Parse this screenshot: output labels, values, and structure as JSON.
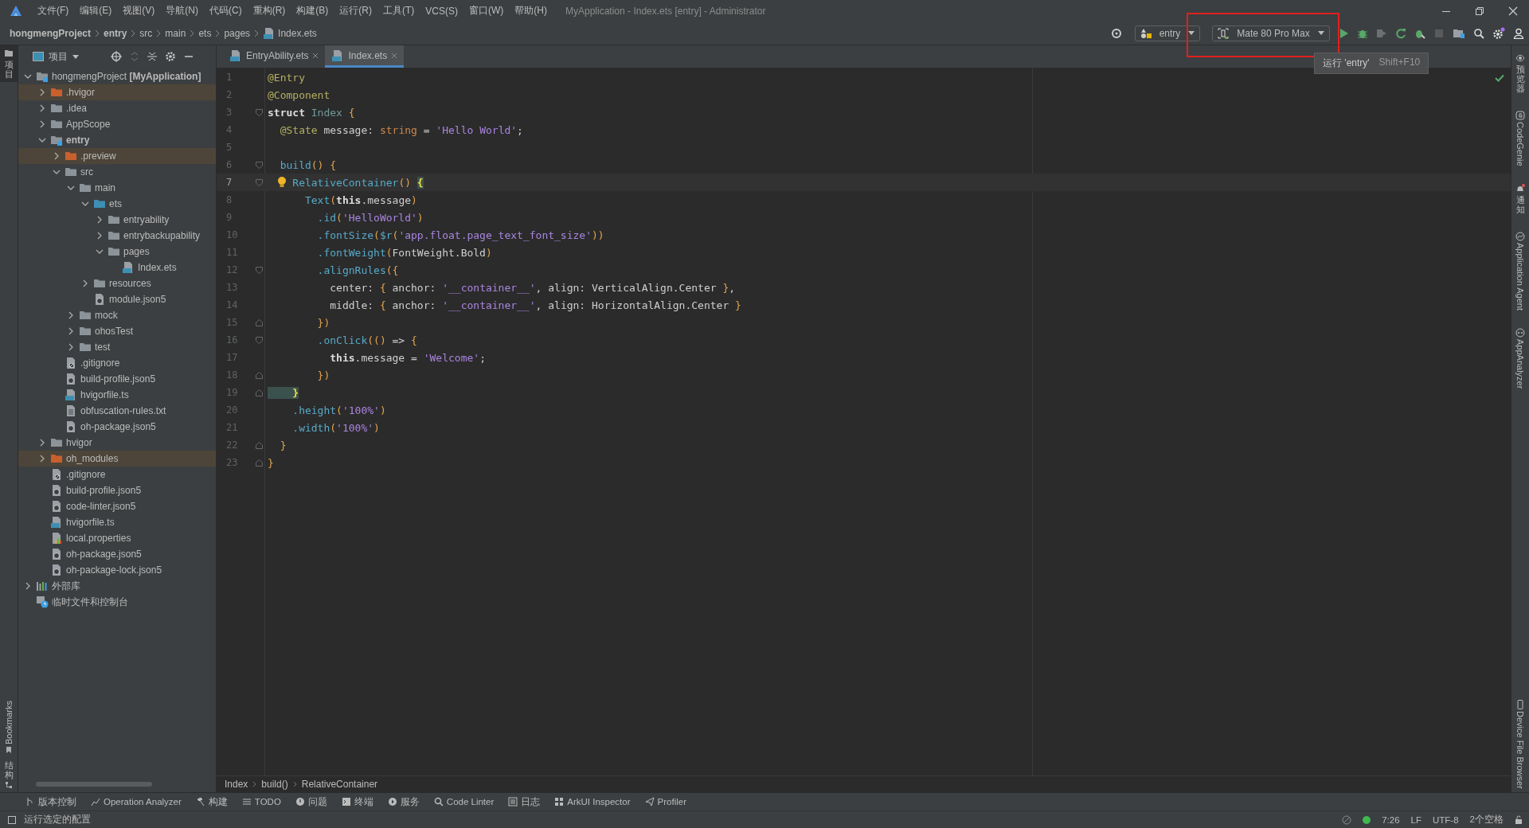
{
  "window": {
    "title": "MyApplication - Index.ets [entry] - Administrator"
  },
  "menu": [
    "文件(F)",
    "编辑(E)",
    "视图(V)",
    "导航(N)",
    "代码(C)",
    "重构(R)",
    "构建(B)",
    "运行(R)",
    "工具(T)",
    "VCS(S)",
    "窗口(W)",
    "帮助(H)"
  ],
  "breadcrumbs": [
    {
      "label": "hongmengProject",
      "kind": "module"
    },
    {
      "label": "entry",
      "kind": "module"
    },
    {
      "label": "src",
      "kind": "folder"
    },
    {
      "label": "main",
      "kind": "folder"
    },
    {
      "label": "ets",
      "kind": "folder"
    },
    {
      "label": "pages",
      "kind": "folder"
    },
    {
      "label": "Index.ets",
      "kind": "file"
    }
  ],
  "run_toolbar": {
    "configuration": "entry",
    "device": "Mate 80 Pro Max",
    "tooltip": {
      "text": "运行 'entry'",
      "shortcut": "Shift+F10"
    }
  },
  "left_strip": [
    {
      "label": "项目",
      "kind": "cjk",
      "selected": true
    },
    {
      "label": "Bookmarks",
      "kind": "latin",
      "selected": false
    },
    {
      "label": "结构",
      "kind": "cjk",
      "selected": false
    }
  ],
  "project_panel": {
    "title": "项目",
    "tree": [
      {
        "label": "hongmengProject **[MyApplication]**",
        "kind": "project",
        "expanded": true,
        "excluded": false,
        "children": [
          {
            "label": ".hvigor",
            "kind": "folder",
            "expanded": false,
            "excluded": true
          },
          {
            "label": ".idea",
            "kind": "folder",
            "expanded": false,
            "excluded": false
          },
          {
            "label": "AppScope",
            "kind": "folder",
            "expanded": false,
            "excluded": false
          },
          {
            "label": "entry",
            "kind": "module",
            "expanded": true,
            "excluded": false,
            "children": [
              {
                "label": ".preview",
                "kind": "folder",
                "expanded": false,
                "excluded": true
              },
              {
                "label": "src",
                "kind": "folder",
                "expanded": true,
                "excluded": false,
                "children": [
                  {
                    "label": "main",
                    "kind": "folder",
                    "expanded": true,
                    "excluded": false,
                    "children": [
                      {
                        "label": "ets",
                        "kind": "source",
                        "expanded": true,
                        "excluded": false,
                        "children": [
                          {
                            "label": "entryability",
                            "kind": "folder",
                            "expanded": false,
                            "excluded": false
                          },
                          {
                            "label": "entrybackupability",
                            "kind": "folder",
                            "expanded": false,
                            "excluded": false
                          },
                          {
                            "label": "pages",
                            "kind": "folder",
                            "expanded": true,
                            "excluded": false,
                            "children": [
                              {
                                "label": "Index.ets",
                                "kind": "ets",
                                "excluded": false
                              }
                            ]
                          }
                        ]
                      },
                      {
                        "label": "resources",
                        "kind": "folder",
                        "expanded": false,
                        "excluded": false
                      },
                      {
                        "label": "module.json5",
                        "kind": "json",
                        "excluded": false
                      }
                    ]
                  },
                  {
                    "label": "mock",
                    "kind": "folder",
                    "expanded": false,
                    "excluded": false
                  },
                  {
                    "label": "ohosTest",
                    "kind": "folder",
                    "expanded": false,
                    "excluded": false
                  },
                  {
                    "label": "test",
                    "kind": "folder",
                    "expanded": false,
                    "excluded": false
                  }
                ]
              },
              {
                "label": ".gitignore",
                "kind": "ignore",
                "excluded": false
              },
              {
                "label": "build-profile.json5",
                "kind": "json",
                "excluded": false
              },
              {
                "label": "hvigorfile.ts",
                "kind": "ts",
                "excluded": false
              },
              {
                "label": "obfuscation-rules.txt",
                "kind": "text",
                "excluded": false
              },
              {
                "label": "oh-package.json5",
                "kind": "json",
                "excluded": false
              }
            ]
          },
          {
            "label": "hvigor",
            "kind": "folder",
            "expanded": false,
            "excluded": false
          },
          {
            "label": "oh_modules",
            "kind": "folder",
            "expanded": false,
            "excluded": true
          },
          {
            "label": ".gitignore",
            "kind": "ignore",
            "excluded": false
          },
          {
            "label": "build-profile.json5",
            "kind": "json",
            "excluded": false
          },
          {
            "label": "code-linter.json5",
            "kind": "json",
            "excluded": false
          },
          {
            "label": "hvigorfile.ts",
            "kind": "ts",
            "excluded": false
          },
          {
            "label": "local.properties",
            "kind": "props",
            "excluded": false
          },
          {
            "label": "oh-package.json5",
            "kind": "json",
            "excluded": false
          },
          {
            "label": "oh-package-lock.json5",
            "kind": "json",
            "excluded": false
          }
        ]
      },
      {
        "label": "外部库",
        "kind": "library",
        "expanded": false,
        "excluded": false
      },
      {
        "label": "临时文件和控制台",
        "kind": "scratch",
        "excluded": false
      }
    ]
  },
  "editor": {
    "tabs": [
      {
        "label": "EntryAbility.ets",
        "selected": false
      },
      {
        "label": "Index.ets",
        "selected": true
      }
    ],
    "lines": [
      {
        "n": "1",
        "current": false,
        "fold_start": false,
        "fold_end": false,
        "tokens": [
          {
            "kind": "ann",
            "text": "@Entry"
          }
        ]
      },
      {
        "n": "2",
        "current": false,
        "fold_start": false,
        "fold_end": false,
        "tokens": [
          {
            "kind": "ann",
            "text": "@Component"
          }
        ]
      },
      {
        "n": "3",
        "current": false,
        "fold_start": true,
        "fold_end": false,
        "tokens": [
          {
            "kind": "kw",
            "text": "struct"
          },
          {
            "kind": "cls",
            "text": " Index"
          },
          {
            "kind": "br",
            "text": " {"
          }
        ]
      },
      {
        "n": "4",
        "current": false,
        "fold_start": false,
        "fold_end": false,
        "tokens": [
          {
            "kind": "ann",
            "text": "  @State"
          },
          {
            "kind": "plain",
            "text": " message: "
          },
          {
            "kind": "type",
            "text": "string"
          },
          {
            "kind": "plain",
            "text": " = "
          },
          {
            "kind": "str",
            "text": "'Hello World'"
          },
          {
            "kind": "plain",
            "text": ";"
          }
        ]
      },
      {
        "n": "5",
        "current": false,
        "fold_start": false,
        "fold_end": false
      },
      {
        "n": "6",
        "current": false,
        "fold_start": true,
        "fold_end": false,
        "tokens": [
          {
            "kind": "fn",
            "text": "  build"
          },
          {
            "kind": "br",
            "text": "() {"
          }
        ]
      },
      {
        "n": "7",
        "current": true,
        "fold_start": true,
        "fold_end": false,
        "tokens": [
          {
            "kind": "fn",
            "text": "    RelativeContainer"
          },
          {
            "kind": "br",
            "text": "() "
          },
          {
            "kind": "match",
            "text": "{"
          }
        ]
      },
      {
        "n": "8",
        "current": false,
        "fold_start": false,
        "fold_end": false,
        "tokens": [
          {
            "kind": "fn",
            "text": "      Text"
          },
          {
            "kind": "br",
            "text": "("
          },
          {
            "kind": "kw",
            "text": "this"
          },
          {
            "kind": "plain",
            "text": ".message"
          },
          {
            "kind": "br",
            "text": ")"
          }
        ]
      },
      {
        "n": "9",
        "current": false,
        "fold_start": false,
        "fold_end": false,
        "tokens": [
          {
            "kind": "fn",
            "text": "        .id"
          },
          {
            "kind": "br",
            "text": "("
          },
          {
            "kind": "str",
            "text": "'HelloWorld'"
          },
          {
            "kind": "br",
            "text": ")"
          }
        ]
      },
      {
        "n": "10",
        "current": false,
        "fold_start": false,
        "fold_end": false,
        "tokens": [
          {
            "kind": "fn",
            "text": "        .fontSize"
          },
          {
            "kind": "br",
            "text": "("
          },
          {
            "kind": "fn",
            "text": "$r"
          },
          {
            "kind": "br",
            "text": "("
          },
          {
            "kind": "str",
            "text": "'app.float.page_text_font_size'"
          },
          {
            "kind": "br",
            "text": "))"
          }
        ]
      },
      {
        "n": "11",
        "current": false,
        "fold_start": false,
        "fold_end": false,
        "tokens": [
          {
            "kind": "fn",
            "text": "        .fontWeight"
          },
          {
            "kind": "br",
            "text": "("
          },
          {
            "kind": "plain",
            "text": "FontWeight.Bold"
          },
          {
            "kind": "br",
            "text": ")"
          }
        ]
      },
      {
        "n": "12",
        "current": false,
        "fold_start": true,
        "fold_end": false,
        "tokens": [
          {
            "kind": "fn",
            "text": "        .alignRules"
          },
          {
            "kind": "br",
            "text": "({"
          }
        ]
      },
      {
        "n": "13",
        "current": false,
        "fold_start": false,
        "fold_end": false,
        "tokens": [
          {
            "kind": "plain",
            "text": "          center: "
          },
          {
            "kind": "br",
            "text": "{"
          },
          {
            "kind": "plain",
            "text": " anchor: "
          },
          {
            "kind": "str",
            "text": "'__container__'"
          },
          {
            "kind": "plain",
            "text": ", align: VerticalAlign.Center "
          },
          {
            "kind": "br",
            "text": "}"
          },
          {
            "kind": "plain",
            "text": ","
          }
        ]
      },
      {
        "n": "14",
        "current": false,
        "fold_start": false,
        "fold_end": false,
        "tokens": [
          {
            "kind": "plain",
            "text": "          middle: "
          },
          {
            "kind": "br",
            "text": "{"
          },
          {
            "kind": "plain",
            "text": " anchor: "
          },
          {
            "kind": "str",
            "text": "'__container__'"
          },
          {
            "kind": "plain",
            "text": ", align: HorizontalAlign.Center "
          },
          {
            "kind": "br",
            "text": "}"
          }
        ]
      },
      {
        "n": "15",
        "current": false,
        "fold_start": false,
        "fold_end": true,
        "tokens": [
          {
            "kind": "br",
            "text": "        })"
          }
        ]
      },
      {
        "n": "16",
        "current": false,
        "fold_start": true,
        "fold_end": false,
        "tokens": [
          {
            "kind": "fn",
            "text": "        .onClick"
          },
          {
            "kind": "br",
            "text": "(() "
          },
          {
            "kind": "plain",
            "text": "=> "
          },
          {
            "kind": "br",
            "text": "{"
          }
        ]
      },
      {
        "n": "17",
        "current": false,
        "fold_start": false,
        "fold_end": false,
        "tokens": [
          {
            "kind": "kw",
            "text": "          this"
          },
          {
            "kind": "plain",
            "text": ".message = "
          },
          {
            "kind": "str",
            "text": "'Welcome'"
          },
          {
            "kind": "plain",
            "text": ";"
          }
        ]
      },
      {
        "n": "18",
        "current": false,
        "fold_start": false,
        "fold_end": true,
        "tokens": [
          {
            "kind": "br",
            "text": "        })"
          }
        ]
      },
      {
        "n": "19",
        "current": false,
        "fold_start": false,
        "fold_end": true,
        "tokens": [
          {
            "kind": "match",
            "text": "    }"
          }
        ]
      },
      {
        "n": "20",
        "current": false,
        "fold_start": false,
        "fold_end": false,
        "tokens": [
          {
            "kind": "fn",
            "text": "    .height"
          },
          {
            "kind": "br",
            "text": "("
          },
          {
            "kind": "str",
            "text": "'100%'"
          },
          {
            "kind": "br",
            "text": ")"
          }
        ]
      },
      {
        "n": "21",
        "current": false,
        "fold_start": false,
        "fold_end": false,
        "tokens": [
          {
            "kind": "fn",
            "text": "    .width"
          },
          {
            "kind": "br",
            "text": "("
          },
          {
            "kind": "str",
            "text": "'100%'"
          },
          {
            "kind": "br",
            "text": ")"
          }
        ]
      },
      {
        "n": "22",
        "current": false,
        "fold_start": false,
        "fold_end": true,
        "tokens": [
          {
            "kind": "br",
            "text": "  }"
          }
        ]
      },
      {
        "n": "23",
        "current": false,
        "fold_start": false,
        "fold_end": true,
        "tokens": [
          {
            "kind": "br",
            "text": "}"
          }
        ]
      }
    ],
    "breadcrumbs": [
      "Index",
      "build()",
      "RelativeContainer"
    ]
  },
  "right_strip": [
    {
      "label": "预览器",
      "kind": "cjk"
    },
    {
      "label": "CodeGenie",
      "kind": "latin"
    },
    {
      "label": "通知",
      "kind": "cjk"
    },
    {
      "label": "Application Agent",
      "kind": "latin"
    },
    {
      "label": "AppAnalyzer",
      "kind": "latin"
    },
    {
      "label": "Device File Browser",
      "kind": "latin"
    }
  ],
  "tool_windows": [
    "版本控制",
    "Operation Analyzer",
    "构建",
    "TODO",
    "问题",
    "终端",
    "服务",
    "Code Linter",
    "日志",
    "ArkUI Inspector",
    "Profiler"
  ],
  "status_bar": {
    "message": "运行选定的配置",
    "items": [
      "7:26",
      "LF",
      "UTF-8",
      "2个空格"
    ]
  }
}
